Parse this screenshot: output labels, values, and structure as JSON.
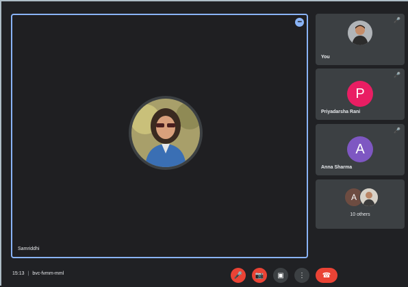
{
  "main": {
    "speaker_name": "Samriddhi"
  },
  "participants": [
    {
      "name": "You",
      "mic": "🎤"
    },
    {
      "name": "Priyadarsha Rani",
      "avatar_letter": "P",
      "avatar_color": "#e91e63",
      "mic": "🎤"
    },
    {
      "name": "Anna Sharma",
      "avatar_letter": "A",
      "avatar_color": "#7e57c2",
      "mic": "🎤"
    }
  ],
  "others": {
    "avatar_letter": "A",
    "label": "10 others"
  },
  "bottom_bar": {
    "time": "15:13",
    "separator": "|",
    "meeting_code": "bvc-fvmm-mml"
  },
  "controls": {
    "mic_icon": "🎤",
    "camera_icon": "📷",
    "present_icon": "▣",
    "more_icon": "⋮",
    "leave_icon": "☎"
  },
  "colors": {
    "accent": "#8ab4f8",
    "danger": "#ea4335",
    "tile_bg": "#3c4043",
    "background": "#202124"
  }
}
